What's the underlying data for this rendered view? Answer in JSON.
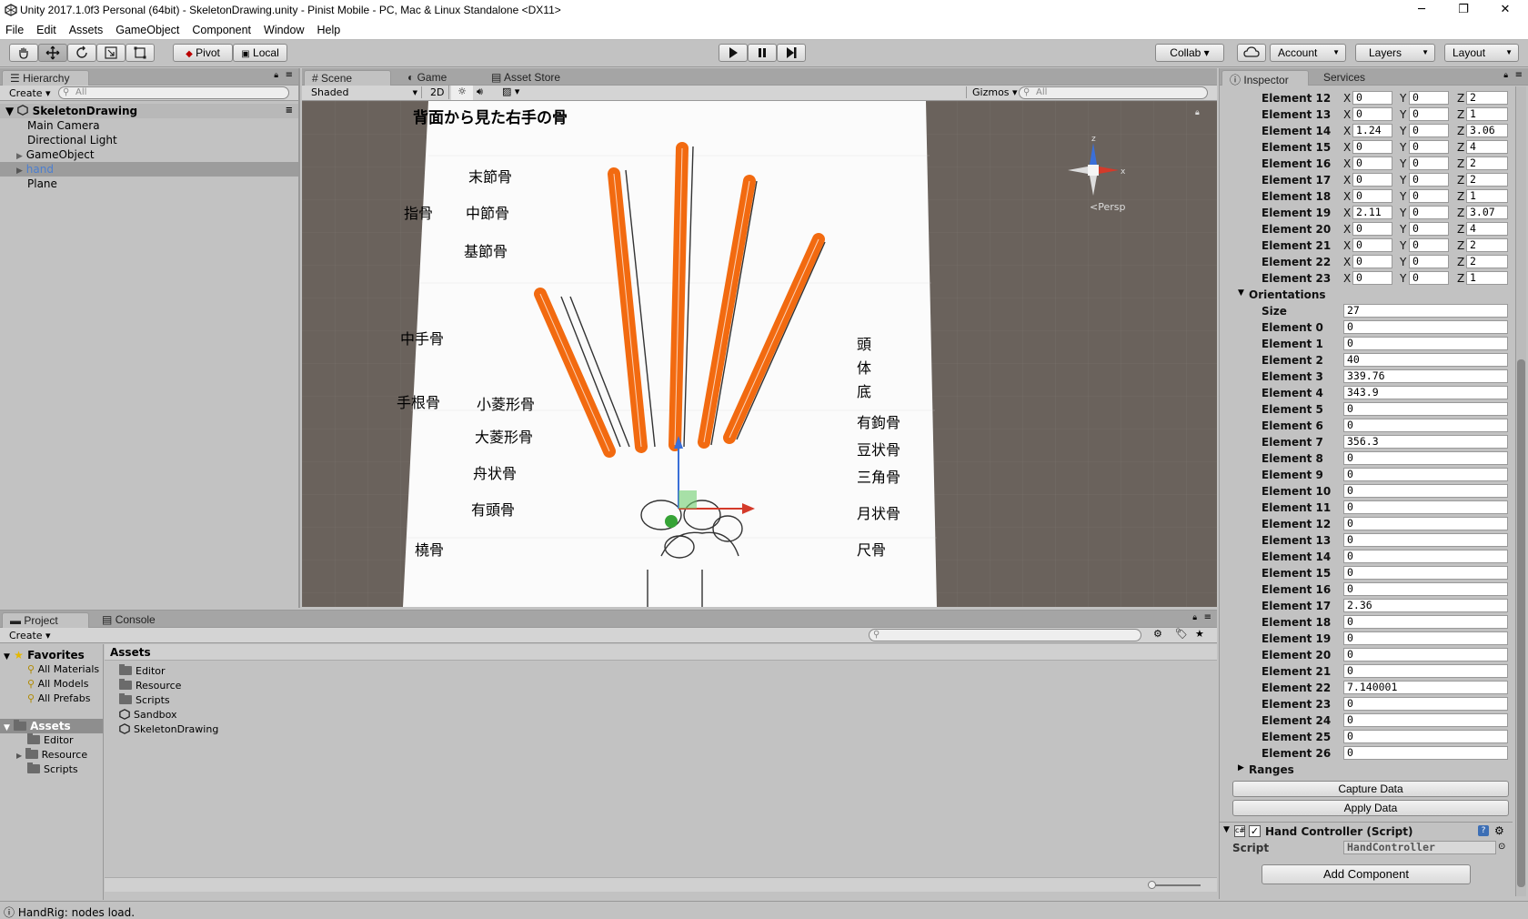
{
  "window": {
    "title": "Unity 2017.1.0f3 Personal (64bit) - SkeletonDrawing.unity - Pinist Mobile - PC, Mac & Linux Standalone <DX11>",
    "minimize": "─",
    "maximize": "❐",
    "close": "✕"
  },
  "menu": [
    "File",
    "Edit",
    "Assets",
    "GameObject",
    "Component",
    "Window",
    "Help"
  ],
  "toolbar": {
    "pivot": "Pivot",
    "local": "Local",
    "collab": "Collab ▾",
    "account": "Account",
    "layers": "Layers",
    "layout": "Layout"
  },
  "hierarchy": {
    "tab": "Hierarchy",
    "create": "Create",
    "search_placeholder": "All",
    "scene": "SkeletonDrawing",
    "items": [
      "Main Camera",
      "Directional Light",
      "GameObject",
      "hand",
      "Plane"
    ]
  },
  "scene": {
    "tabs": [
      "Scene",
      "Game",
      "Asset Store"
    ],
    "shading": "Shaded",
    "mode_2d": "2D",
    "gizmos": "Gizmos",
    "search_placeholder": "All",
    "persp": "Persp",
    "image_title": "背面から見た右手の骨",
    "labels_left": [
      "末節骨",
      "中節骨",
      "基節骨",
      "指骨",
      "中手骨",
      "手根骨",
      "小菱形骨",
      "大菱形骨",
      "舟状骨",
      "有頭骨",
      "橈骨"
    ],
    "labels_right": [
      "頭",
      "体",
      "底",
      "有鉤骨",
      "豆状骨",
      "三角骨",
      "月状骨",
      "尺骨"
    ]
  },
  "project": {
    "tabs": [
      "Project",
      "Console"
    ],
    "create": "Create",
    "favorites_label": "Favorites",
    "favorites": [
      "All Materials",
      "All Models",
      "All Prefabs"
    ],
    "assets_label": "Assets",
    "tree": [
      "Editor",
      "Resource",
      "Scripts"
    ],
    "main_header": "Assets",
    "main_items": [
      "Editor",
      "Resource",
      "Scripts",
      "Sandbox",
      "SkeletonDrawing"
    ]
  },
  "inspector": {
    "tabs": [
      "Inspector",
      "Services"
    ],
    "vector_rows": [
      {
        "label": "Element 12",
        "x": "0",
        "y": "0",
        "z": "2"
      },
      {
        "label": "Element 13",
        "x": "0",
        "y": "0",
        "z": "1"
      },
      {
        "label": "Element 14",
        "x": "1.24",
        "y": "0",
        "z": "3.06"
      },
      {
        "label": "Element 15",
        "x": "0",
        "y": "0",
        "z": "4"
      },
      {
        "label": "Element 16",
        "x": "0",
        "y": "0",
        "z": "2"
      },
      {
        "label": "Element 17",
        "x": "0",
        "y": "0",
        "z": "2"
      },
      {
        "label": "Element 18",
        "x": "0",
        "y": "0",
        "z": "1"
      },
      {
        "label": "Element 19",
        "x": "2.11",
        "y": "0",
        "z": "3.07"
      },
      {
        "label": "Element 20",
        "x": "0",
        "y": "0",
        "z": "4"
      },
      {
        "label": "Element 21",
        "x": "0",
        "y": "0",
        "z": "2"
      },
      {
        "label": "Element 22",
        "x": "0",
        "y": "0",
        "z": "2"
      },
      {
        "label": "Element 23",
        "x": "0",
        "y": "0",
        "z": "1"
      }
    ],
    "axis_x": "X",
    "axis_y": "Y",
    "axis_z": "Z",
    "orientations_label": "Orientations",
    "size_label": "Size",
    "size_value": "27",
    "orientations": [
      "0",
      "0",
      "40",
      "339.76",
      "343.9",
      "0",
      "0",
      "356.3",
      "0",
      "0",
      "0",
      "0",
      "0",
      "0",
      "0",
      "0",
      "0",
      "2.36",
      "0",
      "0",
      "0",
      "0",
      "7.140001",
      "0",
      "0",
      "0",
      "0"
    ],
    "ranges_label": "Ranges",
    "capture": "Capture Data",
    "apply": "Apply Data",
    "component": "Hand Controller (Script)",
    "script_label": "Script",
    "script_value": "HandController",
    "add_component": "Add Component"
  },
  "status": {
    "message": "HandRig: nodes load."
  }
}
